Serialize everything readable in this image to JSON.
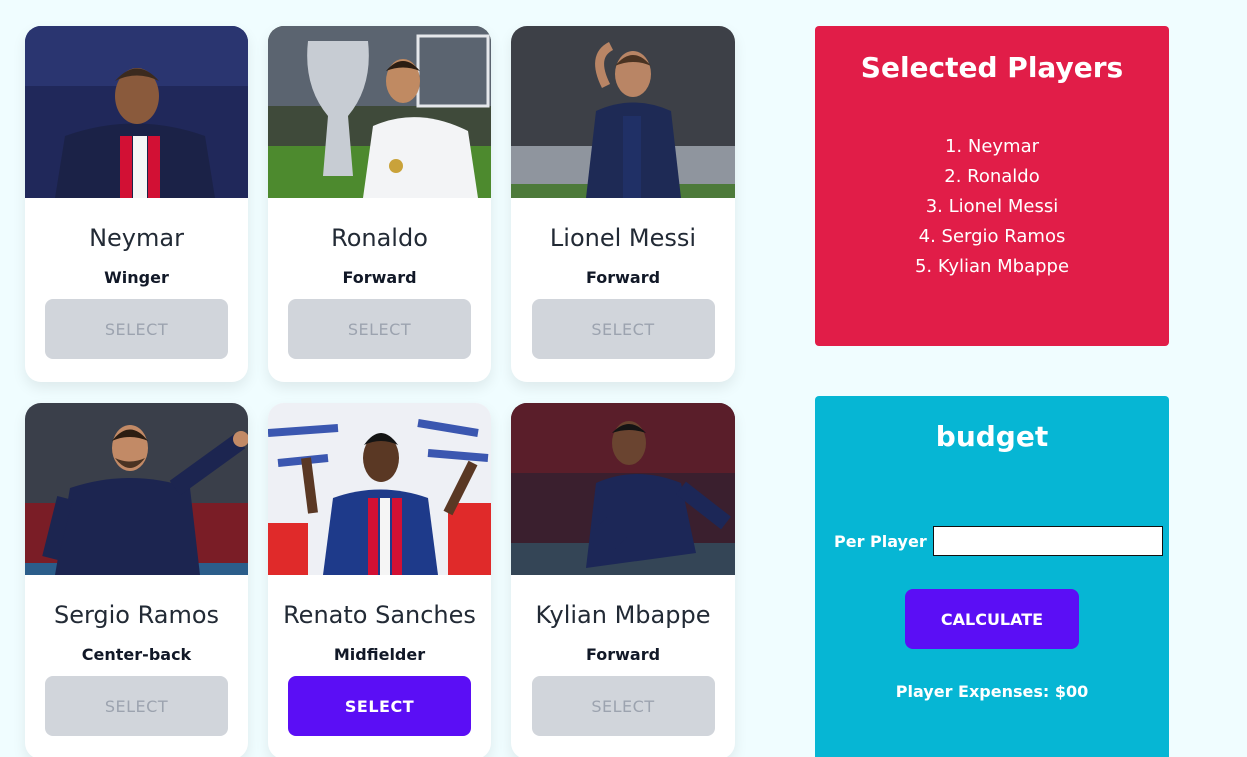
{
  "players": [
    {
      "name": "Neymar",
      "role": "Winger",
      "button": "SELECT",
      "selected": true
    },
    {
      "name": "Ronaldo",
      "role": "Forward",
      "button": "SELECT",
      "selected": true
    },
    {
      "name": "Lionel Messi",
      "role": "Forward",
      "button": "SELECT",
      "selected": true
    },
    {
      "name": "Sergio Ramos",
      "role": "Center-back",
      "button": "SELECT",
      "selected": true
    },
    {
      "name": "Renato Sanches",
      "role": "Midfielder",
      "button": "SELECT",
      "selected": false
    },
    {
      "name": "Kylian Mbappe",
      "role": "Forward",
      "button": "SELECT",
      "selected": true
    }
  ],
  "selected": {
    "title": "Selected Players",
    "items": [
      "1. Neymar",
      "2. Ronaldo",
      "3. Lionel Messi",
      "4. Sergio Ramos",
      "5. Kylian Mbappe"
    ]
  },
  "budget": {
    "title": "budget",
    "per_player_label": "Per Player",
    "per_player_value": "",
    "calculate_label": "CALCULATE",
    "expenses_text": "Player Expenses: $00"
  },
  "colors": {
    "selected_panel": "#e11d48",
    "budget_panel": "#06b6d4",
    "accent_button": "#5b0ef5",
    "disabled_button": "#d1d5db"
  }
}
